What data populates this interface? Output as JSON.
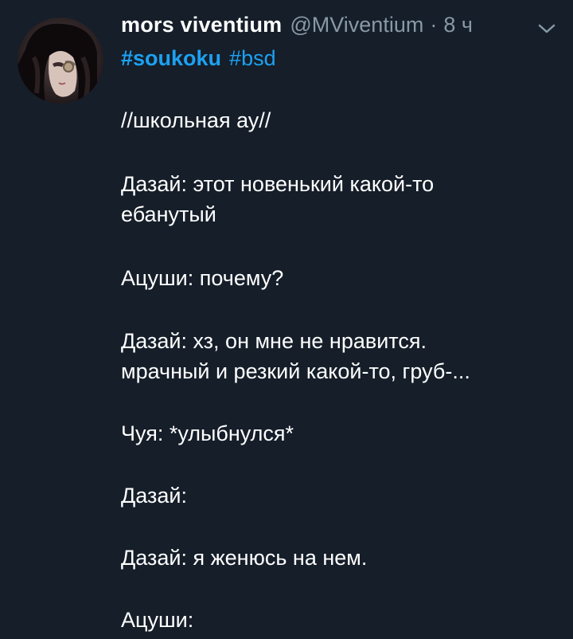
{
  "tweet": {
    "display_name": "mors viventium",
    "handle": "@MViventium",
    "separator": "·",
    "time": "8 ч",
    "hashtags": [
      {
        "text": "#soukoku",
        "bold": true
      },
      {
        "text": "#bsd",
        "bold": false
      }
    ],
    "lines": [
      "//школьная ау//",
      "Дазай: этот новенький какой-то",
      "ебанутый",
      "Ацуши: почему?",
      "Дазай: хз, он мне не нравится.",
      "мрачный и резкий какой-то, груб-...",
      "Чуя: *улыбнулся*",
      "Дазай:",
      "Дазай: я женюсь на нем.",
      "Ацуши:"
    ]
  },
  "icons": {
    "menu": "chevron-down-icon"
  },
  "colors": {
    "background": "#151e29",
    "text": "#ffffff",
    "secondary": "#8899a6",
    "link": "#1da1f2"
  }
}
